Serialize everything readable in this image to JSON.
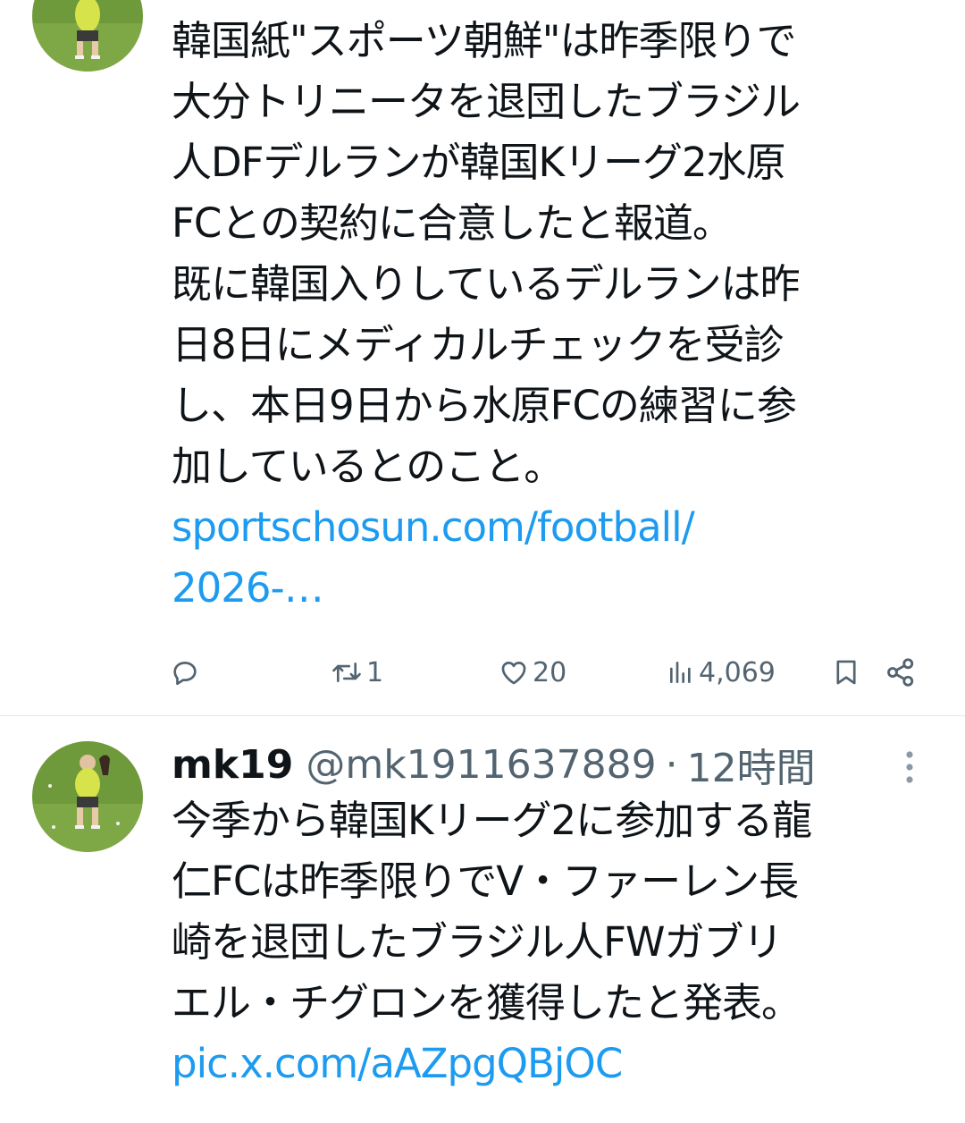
{
  "tweets": [
    {
      "lines": [
        "韓国紙\"スポーツ朝鮮\"は昨季限りで",
        "大分トリニータを退団したブラジル",
        "人DFデルランが韓国Kリーグ2水原",
        "FCとの契約に合意したと報道。",
        "既に韓国入りしているデルランは昨",
        "日8日にメディカルチェックを受診",
        "し、本日9日から水原FCの練習に参",
        "加しているとのこと。"
      ],
      "link_lines": [
        "sportschosun.com/football/",
        "2026-…"
      ],
      "actions": {
        "replies": "",
        "retweets": "1",
        "likes": "20",
        "views": "4,069"
      }
    },
    {
      "author": {
        "display_name": "mk19",
        "handle": "@mk1911637889",
        "separator": "·",
        "time": "12時間"
      },
      "lines": [
        "今季から韓国Kリーグ2に参加する龍",
        "仁FCは昨季限りでV・ファーレン長",
        "崎を退団したブラジル人FWガブリ",
        "エル・チグロンを獲得したと発表。"
      ],
      "link": "pic.x.com/aAZpgQBjOC"
    }
  ],
  "icons": {
    "reply": "reply-icon",
    "retweet": "retweet-icon",
    "like": "heart-icon",
    "views": "views-icon",
    "bookmark": "bookmark-icon",
    "share": "share-icon",
    "more": "more-vertical-icon"
  },
  "colors": {
    "text": "#0f1419",
    "secondary": "#536471",
    "link": "#1d9bf0",
    "divider": "#e5e8eb"
  }
}
